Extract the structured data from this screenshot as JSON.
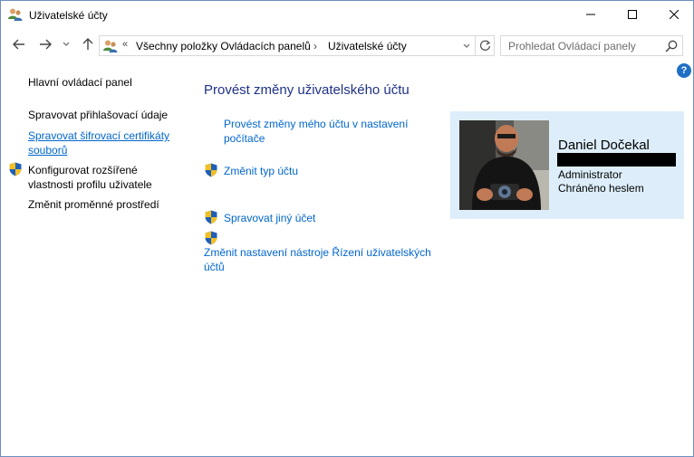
{
  "window": {
    "title": "Uživatelské účty"
  },
  "address": {
    "crumbs": [
      "Všechny položky Ovládacích panelů",
      "Uživatelské účty"
    ],
    "separator": "«",
    "arrow": "›"
  },
  "search": {
    "placeholder": "Prohledat Ovládací panely"
  },
  "left_nav": {
    "items": [
      "Hlavní ovládací panel",
      "Spravovat přihlašovací údaje",
      "Spravovat šifrovací certifikáty souborů",
      "Konfigurovat rozšířené vlastnosti profilu uživatele",
      "Změnit proměnné prostředí"
    ],
    "item3_lines": [
      "Spravovat šifrovací certifikáty",
      "souborů"
    ],
    "item4_lines": [
      "Konfigurovat rozšířené",
      "vlastnosti profilu uživatele"
    ]
  },
  "main": {
    "heading": "Provést změny uživatelského účtu",
    "tasks": [
      "Provést změny mého účtu v nastavení počítače",
      "Změnit typ účtu",
      "Spravovat jiný účet",
      "Změnit nastavení nástroje Řízení uživatelských účtů"
    ],
    "task1_lines": [
      "Provést změny mého účtu v nastavení",
      "počítače"
    ],
    "task4_lines": [
      "Změnit nastavení nástroje Řízení uživatelských",
      "účtů"
    ]
  },
  "user": {
    "name": "Daniel Dočekal",
    "role": "Administrator",
    "status": "Chráněno heslem"
  },
  "icons": {
    "window": "users-icon",
    "help": "help-icon",
    "shield": "uac-shield-icon"
  },
  "colors": {
    "heading": "#1e3287",
    "link": "#0066cc",
    "card_bg": "#ddeefa",
    "help_bg": "#1f6fc5"
  }
}
